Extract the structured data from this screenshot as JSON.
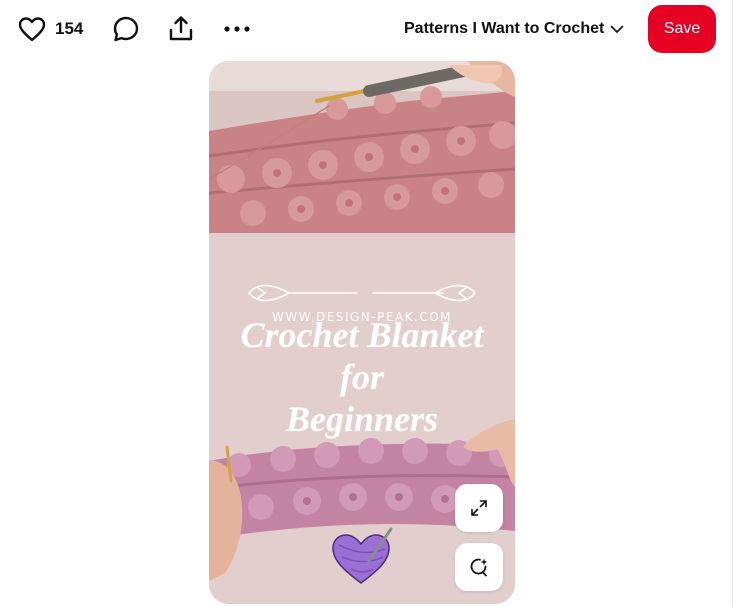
{
  "toolbar": {
    "like_icon": "heart-icon",
    "like_count": "154",
    "comment_icon": "comment-icon",
    "share_icon": "share-icon",
    "more_icon": "more-icon",
    "board_name": "Patterns I Want to Crochet",
    "board_chevron_icon": "chevron-down-icon",
    "save_label": "Save"
  },
  "pin": {
    "site": "WWW.DESIGN-PEAK.COM",
    "title": "Crochet Blanket\nfor\nBeginners",
    "expand_icon": "expand-icon",
    "visual_search_icon": "visual-search-icon",
    "logo": "yarn-heart-logo"
  },
  "colors": {
    "save": "#e60023",
    "pin_background": "#e2cfcd",
    "crochet_top": "#c98385",
    "crochet_bottom": "#c384a3",
    "yarn_heart": "#9b6fd6"
  }
}
